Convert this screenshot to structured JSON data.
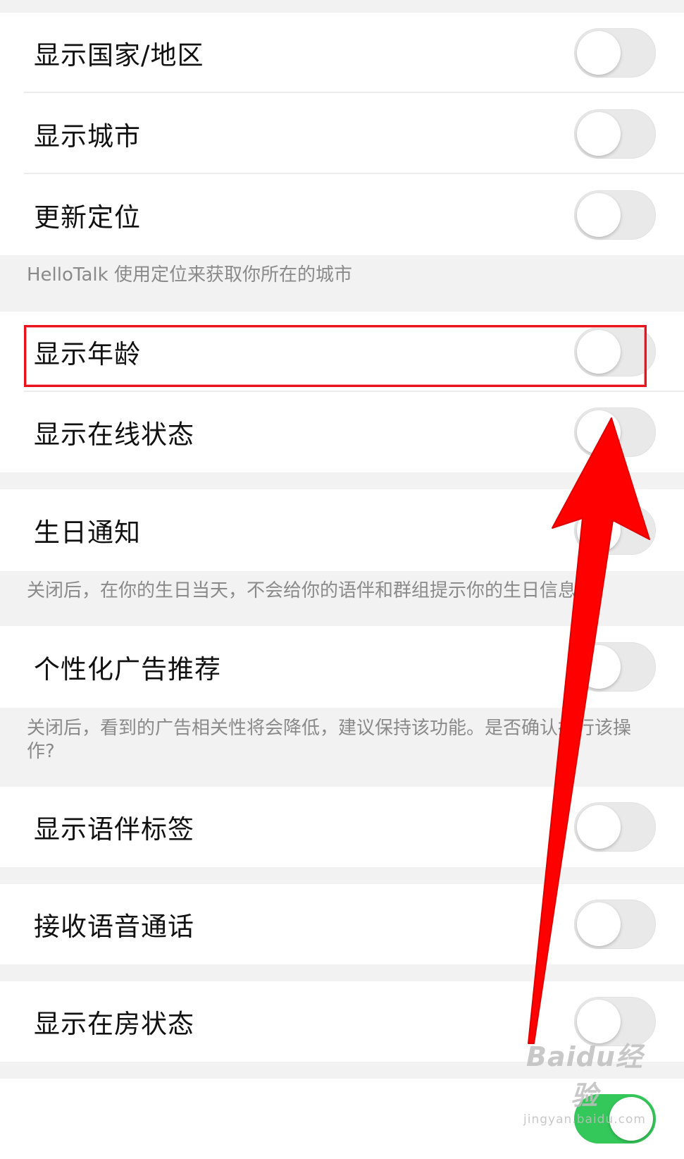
{
  "settings": [
    {
      "label": "显示国家/地区",
      "on": false
    },
    {
      "label": "显示城市",
      "on": false
    },
    {
      "label": "更新定位",
      "on": false
    },
    {
      "label": "显示年龄",
      "on": false
    },
    {
      "label": "显示在线状态",
      "on": false
    },
    {
      "label": "生日通知",
      "on": false
    },
    {
      "label": "个性化广告推荐",
      "on": false
    },
    {
      "label": "显示语伴标签",
      "on": false
    },
    {
      "label": "接收语音通话",
      "on": false
    },
    {
      "label": "显示在房状态",
      "on": false
    },
    {
      "label": "",
      "on": true
    }
  ],
  "notes": {
    "location": "HelloTalk 使用定位来获取你所在的城市",
    "birthday": "关闭后，在你的生日当天，不会给你的语伴和群组提示你的生日信息",
    "ads": "关闭后，看到的广告相关性将会降低，建议保持该功能。是否确认执行该操作?"
  },
  "annotation": {
    "highlight_color": "#e8131d",
    "arrow_color": "#ff0000"
  },
  "watermark": {
    "brand": "Baidu经验",
    "site": "jingyan.baidu.com"
  }
}
